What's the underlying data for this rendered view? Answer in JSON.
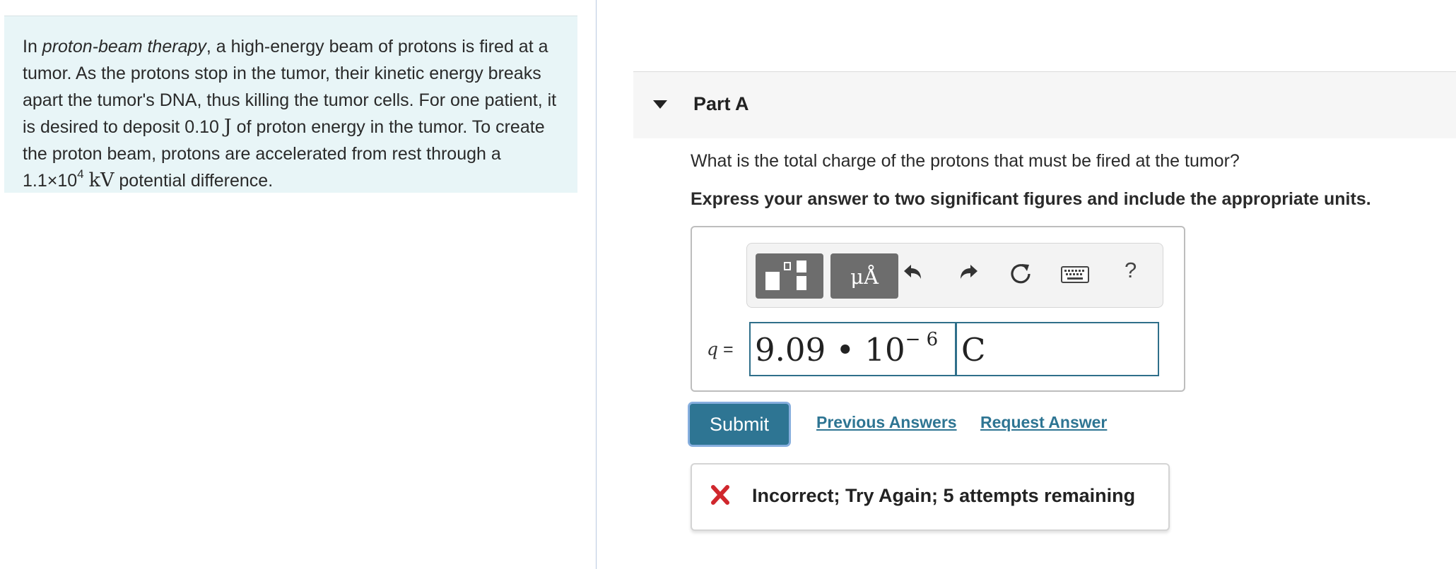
{
  "problem": {
    "intro": "In ",
    "emphasis": "proton-beam therapy",
    "body1": ", a high-energy beam of protons is fired at a tumor. As the protons stop in the tumor, their kinetic energy breaks apart the tumor's DNA, thus killing the tumor cells. For one patient, it is desired to deposit 0.10 ",
    "energy_unit": "J",
    "body2": " of proton energy in the tumor. To create the proton beam, protons are accelerated from rest through a 1.1×10",
    "exponent": "4",
    "space": " ",
    "voltage_unit": "kV",
    "body3": " potential difference."
  },
  "part": {
    "title": "Part A",
    "question": "What is the total charge of the protons that must be fired at the tumor?",
    "instruction": "Express your answer to two significant figures and include the appropriate units."
  },
  "toolbar": {
    "units_label": "μÅ",
    "help_label": "?",
    "icons": [
      "templates-icon",
      "units-icon",
      "undo-icon",
      "redo-icon",
      "reset-icon",
      "keyboard-icon",
      "help-icon"
    ]
  },
  "answer": {
    "variable": "q",
    "equals": " =",
    "value_mantissa": "9.09 • 10",
    "value_exponent": "− 6",
    "units_value": "C"
  },
  "actions": {
    "submit_label": "Submit",
    "previous_answers_label": "Previous Answers",
    "request_answer_label": "Request Answer"
  },
  "feedback": {
    "message": "Incorrect; Try Again; 5 attempts remaining",
    "status_color": "#d0272d"
  },
  "colors": {
    "problem_bg": "#e8f5f7",
    "accent": "#2e7593",
    "input_border": "#2f6f8a"
  }
}
